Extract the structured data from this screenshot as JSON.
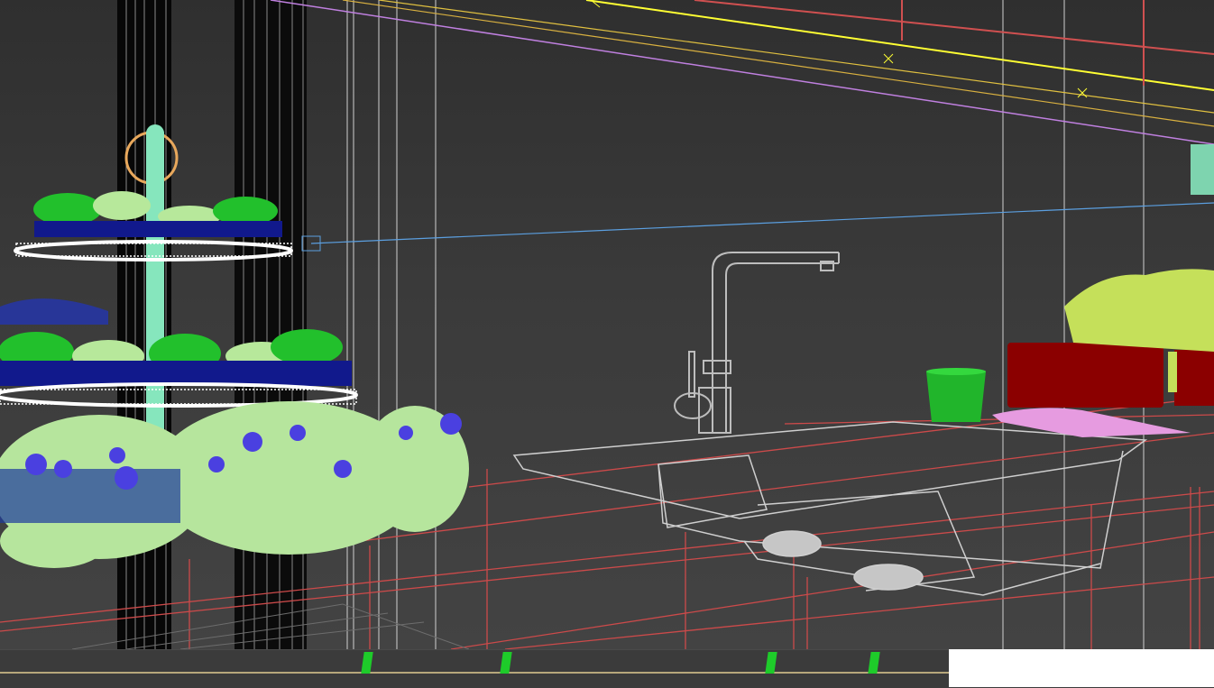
{
  "viewport": {
    "shading_mode": "wireframe",
    "background_color": "#3c3c3c",
    "object_colors": {
      "cake_stand_pole": "#86e6bd",
      "cupcake_frosting": "#22c02c",
      "cupcake_light": "#b7e89b",
      "cupcake_liner": "#11198c",
      "plate_rim": "#ffffff",
      "flowers_leaves": "#b6e59d",
      "flowers_blossoms": "#4a40e0",
      "faucet": "#bdbdbd",
      "sink": "#cfcfcf",
      "cup": "#21b52b",
      "cutting_board": "#8b0000",
      "towel": "#e69be0",
      "plant": "#c5e05a",
      "counter_edges": "#cc4a4a",
      "guide_line": "#5b9fe0",
      "ceiling_lights": "#ffff33"
    }
  },
  "timeline": {
    "track_color": "#b7a77b",
    "marker_color": "#1ecb2a"
  },
  "blank_panel": {
    "color": "#ffffff"
  }
}
